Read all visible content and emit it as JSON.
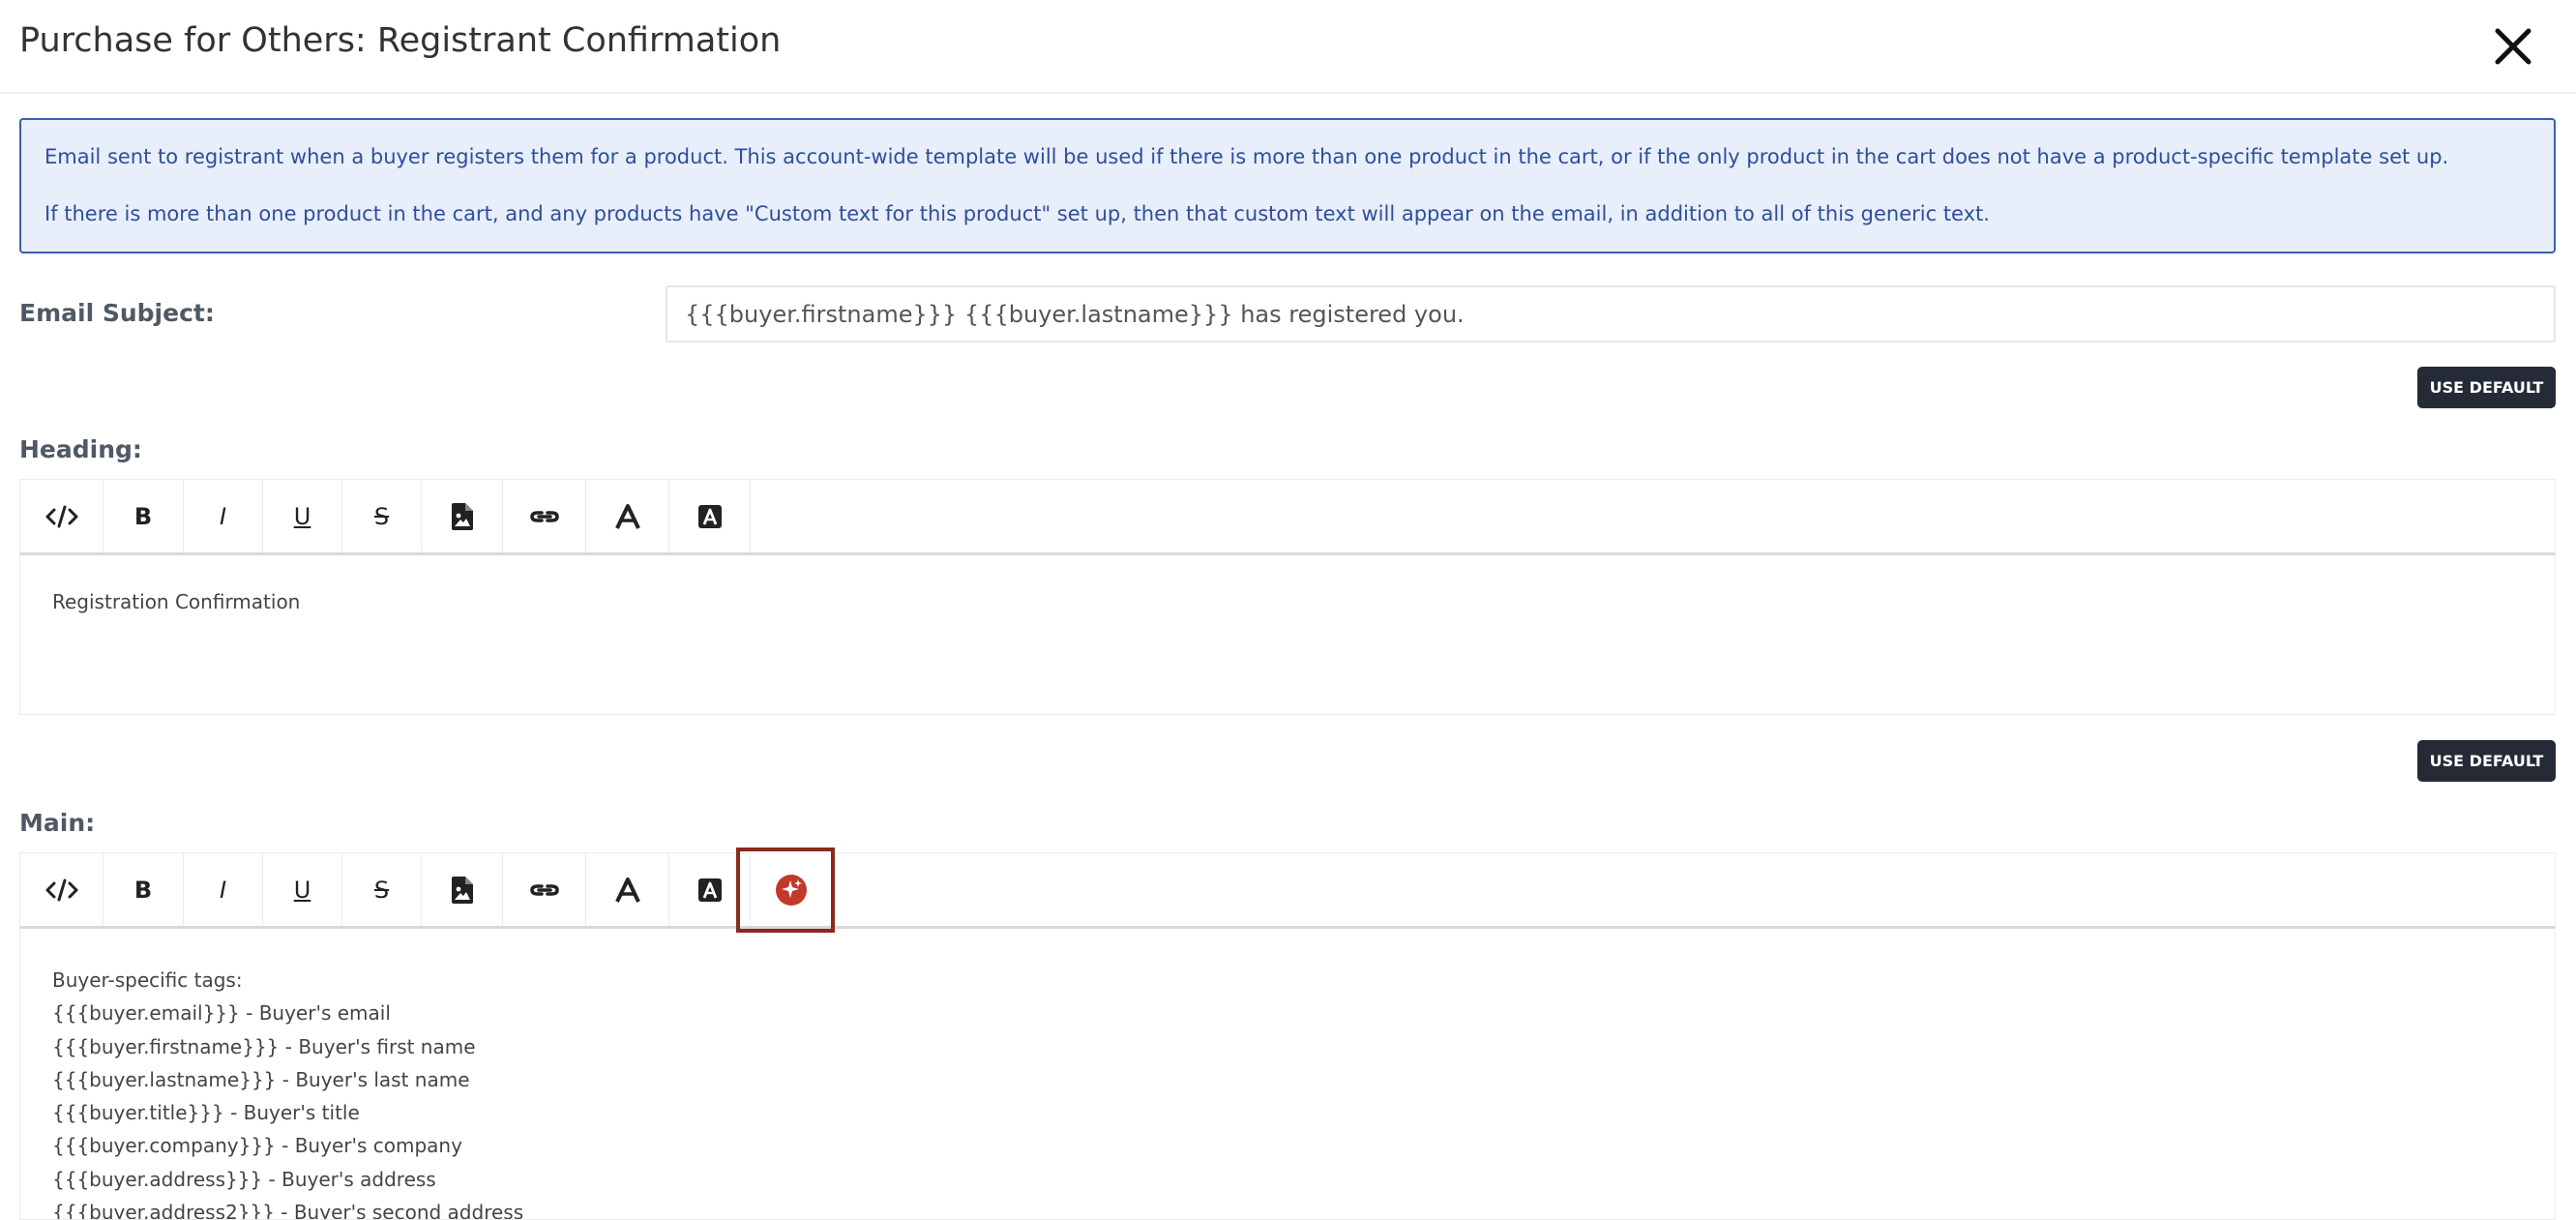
{
  "header": {
    "title": "Purchase for Others: Registrant Confirmation",
    "close_icon": "close-icon"
  },
  "info": {
    "line1": "Email sent to registrant when a buyer registers them for a product. This account-wide template will be used if there is more than one product in the cart, or if the only product in the cart does not have a product-specific template set up.",
    "line2": "If there is more than one product in the cart, and any products have \"Custom text for this product\" set up, then that custom text will appear on the email, in addition to all of this generic text."
  },
  "subject": {
    "label": "Email Subject:",
    "value": "{{{buyer.firstname}}} {{{buyer.lastname}}} has registered you."
  },
  "buttons": {
    "use_default": "USE DEFAULT"
  },
  "heading_section": {
    "label": "Heading:",
    "content": "Registration Confirmation"
  },
  "toolbar": {
    "buttons": [
      {
        "name": "code-view",
        "icon": "code-icon"
      },
      {
        "name": "bold",
        "label": "B"
      },
      {
        "name": "italic",
        "label": "I"
      },
      {
        "name": "underline",
        "label": "U"
      },
      {
        "name": "strikethrough",
        "label": "S"
      },
      {
        "name": "insert-image",
        "icon": "image-file-icon"
      },
      {
        "name": "insert-link",
        "icon": "link-icon"
      },
      {
        "name": "font-color",
        "icon": "font-color-icon"
      },
      {
        "name": "background-color",
        "icon": "font-background-icon"
      }
    ],
    "extra_button": {
      "name": "ai-assistant",
      "icon": "sparkle-icon",
      "color": "#c0392b",
      "highlight": "#8b2a1a"
    }
  },
  "main_section": {
    "label": "Main:",
    "lines": [
      "Buyer-specific tags:",
      "{{{buyer.email}}} - Buyer's email",
      "{{{buyer.firstname}}} - Buyer's first name",
      "{{{buyer.lastname}}} - Buyer's last name",
      "{{{buyer.title}}} - Buyer's title",
      "{{{buyer.company}}} - Buyer's company",
      "{{{buyer.address}}} - Buyer's address",
      "{{{buyer.address2}}} - Buyer's second address"
    ]
  },
  "colors": {
    "info_bg": "#e8eefa",
    "info_border": "#3b5fb0",
    "info_text": "#2d4f9c",
    "button_bg": "#252b36"
  }
}
